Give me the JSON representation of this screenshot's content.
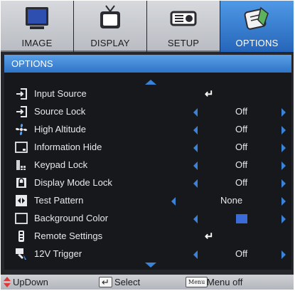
{
  "colors": {
    "accent": "#3a83d8",
    "active_tab": "#2767bb",
    "background_color_swatch": "#3a6bd8"
  },
  "tabs": [
    {
      "label": "IMAGE",
      "icon": "monitor-icon"
    },
    {
      "label": "DISPLAY",
      "icon": "tv-icon"
    },
    {
      "label": "SETUP",
      "icon": "projector-icon"
    },
    {
      "label": "OPTIONS",
      "icon": "options-notepad-icon"
    }
  ],
  "menu": {
    "title": "OPTIONS",
    "items": [
      {
        "label": "Input Source",
        "value": "",
        "icon": "input-source-icon"
      },
      {
        "label": "Source Lock",
        "value": "Off",
        "icon": "source-lock-icon"
      },
      {
        "label": "High Altitude",
        "value": "Off",
        "icon": "fan-icon"
      },
      {
        "label": "Information Hide",
        "value": "Off",
        "icon": "info-hide-icon"
      },
      {
        "label": "Keypad Lock",
        "value": "Off",
        "icon": "keypad-icon"
      },
      {
        "label": "Display Mode Lock",
        "value": "Off",
        "icon": "lock-icon"
      },
      {
        "label": "Test Pattern",
        "value": "None",
        "icon": "test-pattern-icon"
      },
      {
        "label": "Background Color",
        "value": "",
        "icon": "background-color-icon"
      },
      {
        "label": "Remote Settings",
        "value": "",
        "icon": "remote-icon"
      },
      {
        "label": "12V Trigger",
        "value": "Off",
        "icon": "12v-trigger-icon"
      }
    ]
  },
  "footer": {
    "updown_label": "UpDown",
    "select_label": "Select",
    "menu_key": "Menu",
    "menuoff_label": "Menu off"
  }
}
